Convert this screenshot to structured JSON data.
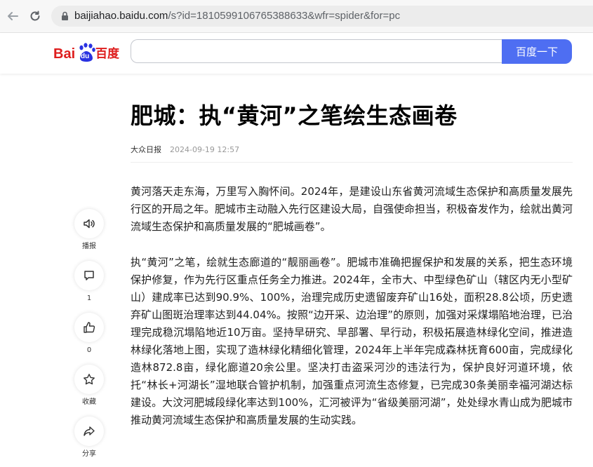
{
  "browser": {
    "url_host": "baijiahao.baidu.com",
    "url_path": "/s?id=1810599106765388633&wfr=spider&for=pc"
  },
  "header": {
    "logo_bai": "Bai",
    "logo_du": "du",
    "logo_cn": "百度",
    "search_value": "",
    "search_button": "百度一下"
  },
  "article": {
    "title": "肥城：执“黄河”之笔绘生态画卷",
    "source": "大众日报",
    "time": "2024-09-19 12:57",
    "paragraphs": [
      "黄河落天走东海，万里写入胸怀间。2024年，是建设山东省黄河流域生态保护和高质量发展先行区的开局之年。肥城市主动融入先行区建设大局，自强使命担当，积极奋发作为，绘就出黄河流域生态保护和高质量发展的“肥城画卷”。",
      "执“黄河”之笔，绘就生态廊道的“靓丽画卷”。肥城市准确把握保护和发展的关系，把生态环境保护修复，作为先行区重点任务全力推进。2024年，全市大、中型绿色矿山（辖区内无小型矿山）建成率已达到90.9%、100%，治理完成历史遗留废弃矿山16处，面积28.8公顷，历史遗弃矿山图斑治理率达到44.04%。按照“边开采、边治理”的原则，加强对采煤塌陷地治理，已治理完成稳沉塌陷地近10万亩。坚持早研究、早部署、早行动，积极拓展造林绿化空间，推进造林绿化落地上图，实现了造林绿化精细化管理，2024年上半年完成森林抚育600亩，完成绿化造林872.8亩，绿化廊道20余公里。坚决打击盗采河沙的违法行为，保护良好河道环境，依托“林长+河湖长”湿地联合管护机制，加强重点河流生态修复，已完成30条美丽幸福河湖达标建设。大汶河肥城段绿化率达到100%，汇河被评为“省级美丽河湖”，处处绿水青山成为肥城市推动黄河流域生态保护和高质量发展的生动实践。"
    ]
  },
  "sidebar": {
    "broadcast_label": "播报",
    "comment_count": "1",
    "like_count": "0",
    "favorite_label": "收藏",
    "share_label": "分享"
  },
  "colors": {
    "accent": "#4e6ef2",
    "logo_red": "#de1e1e",
    "logo_blue": "#2932e1"
  },
  "icons": [
    "back-arrow-icon",
    "reload-icon",
    "lock-icon",
    "baidu-paw-icon",
    "speaker-icon",
    "comment-icon",
    "thumbs-up-icon",
    "star-icon",
    "share-icon"
  ]
}
